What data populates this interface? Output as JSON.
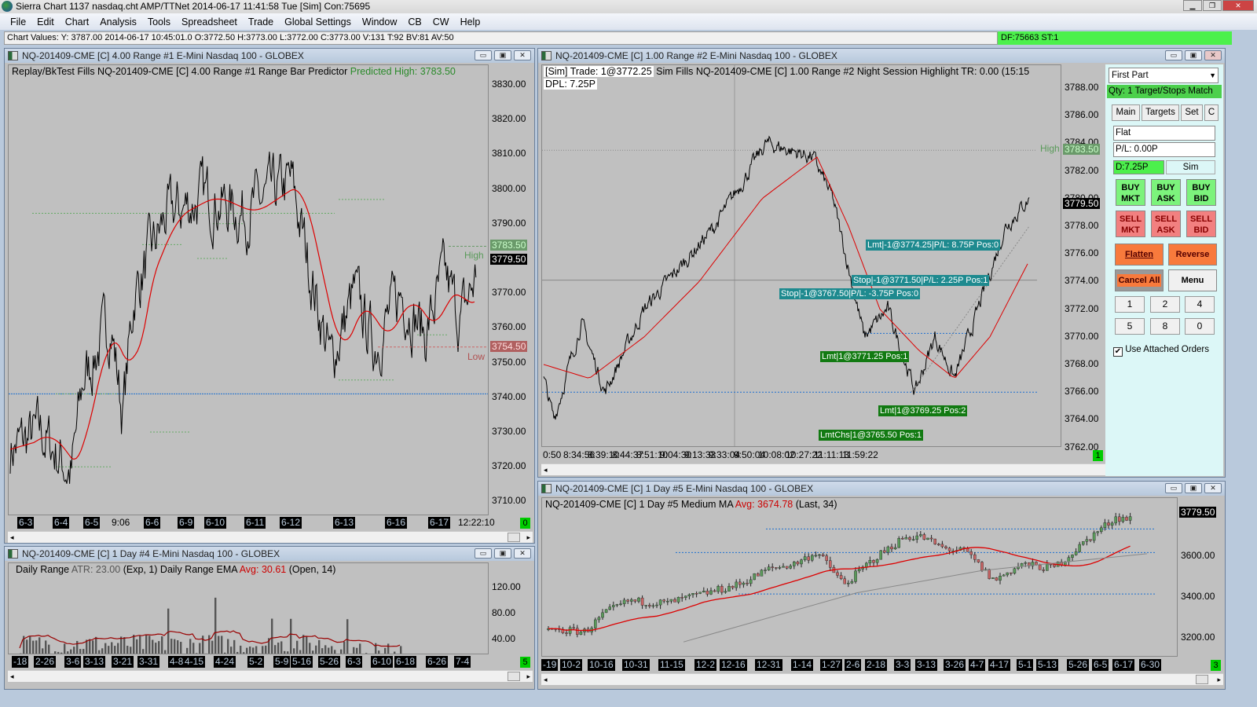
{
  "app": {
    "title": "Sierra Chart 1137 nasdaq.cht  AMP/TTNet 2014-06-17  11:41:58 Tue [Sim]  Con:75695",
    "controls": [
      "▁",
      "❐",
      "✕"
    ]
  },
  "menu": [
    "File",
    "Edit",
    "Chart",
    "Analysis",
    "Tools",
    "Spreadsheet",
    "Trade",
    "Global Settings",
    "Window",
    "CB",
    "CW",
    "Help"
  ],
  "chart_values": "Chart Values: Y: 3787.00  2014-06-17  10:45:01.0  O:3772.50  H:3773.00  L:3772.00  C:3773.00  V:131  T:92  BV:81  AV:50",
  "status": "DF:75663  ST:1",
  "win_controls": [
    "▭",
    "▣",
    "✕"
  ],
  "chart1": {
    "title": "NQ-201409-CME [C]  4.00 Range  #1  E-Mini Nasdaq 100 - GLOBEX",
    "header": "Replay/BkTest Fills  NQ-201409-CME [C]  4.00 Range  #1  Range Bar Predictor",
    "predicted": "Predicted High: 3783.50",
    "prices": [
      "3830.00",
      "3820.00",
      "3810.00",
      "3800.00",
      "3790.00",
      "3780.00",
      "3770.00",
      "3760.00",
      "3750.00",
      "3740.00",
      "3730.00",
      "3720.00",
      "3710.00"
    ],
    "high_label": "High",
    "high_value": "3783.50",
    "last_value": "3779.50",
    "low_label": "Low",
    "low_value": "3754.50",
    "times": [
      "6-3",
      "6-4",
      "6-5",
      "9:06",
      "6-6",
      "6-9",
      "6-10",
      "6-11",
      "6-12",
      "6-13",
      "6-16",
      "6-17",
      "12:22:10"
    ],
    "indicator": "0"
  },
  "chart4": {
    "title": "NQ-201409-CME [C]  1 Day   #4  E-Mini Nasdaq 100 - GLOBEX",
    "h1": "Daily Range",
    "h2": "ATR: 23.00",
    "h3": "(Exp, 1)  Daily Range EMA",
    "h4": "Avg: 30.61",
    "h5": "(Open, 14)",
    "prices": [
      "120.00",
      "80.00",
      "40.00"
    ],
    "times": [
      "-18",
      "2-26",
      "3-6",
      "3-13",
      "3-21",
      "3-31",
      "4-8",
      "4-15",
      "4-24",
      "5-2",
      "5-9",
      "5-16",
      "5-26",
      "6-3",
      "6-10",
      "6-18",
      "6-26",
      "7-4"
    ],
    "indicator": "5"
  },
  "chart2": {
    "title": "NQ-201409-CME [C]  1.00 Range  #2  E-Mini Nasdaq 100 - GLOBEX",
    "sim": "[Sim]  Trade: 1@3772.25",
    "header": " Sim Fills  NQ-201409-CME [C]  1.00 Range  #2  Night Session Highlight  TR: 0.00   (15:15",
    "dpl": "DPL: 7.25P",
    "prices": [
      "3788.00",
      "3786.00",
      "3784.00",
      "3782.00",
      "3780.00",
      "3778.00",
      "3776.00",
      "3774.00",
      "3772.00",
      "3770.00",
      "3768.00",
      "3766.00",
      "3764.00",
      "3762.00"
    ],
    "high_label": "High",
    "high_value": "3783.50",
    "last_value": "3779.50",
    "orders": [
      "Lmt|-1@3774.25|P/L: 8.75P Pos:0",
      "Stop|-1@3771.50|P/L: 2.25P Pos:1",
      "Stop|-1@3767.50|P/L: -3.75P Pos:0",
      "Lmt|1@3771.25 Pos:1",
      "Lmt|1@3769.25 Pos:2",
      "LmtChs|1@3765.50 Pos:1"
    ],
    "times": [
      "0:50",
      "8:34:56",
      "8:39:10",
      "8:44:37",
      "8:51:10",
      "9:04:30",
      "9:13:33",
      "9:33:04",
      "9:50:04",
      "10:08:02",
      "10:27:22",
      "11:11:13",
      "11:59:22"
    ],
    "indicator": "1"
  },
  "trade": {
    "mode": "First Part",
    "qty": "Qty: 1 Target/Stops Match",
    "tabs": [
      "Main",
      "Targets",
      "Set",
      "C"
    ],
    "position": "Flat",
    "pl": "P/L: 0.00P",
    "d": "D:7.25P",
    "sim": "Sim",
    "buy": [
      "BUY MKT",
      "BUY ASK",
      "BUY BID"
    ],
    "sell": [
      "SELL MKT",
      "SELL ASK",
      "SELL BID"
    ],
    "flatten": "Flatten",
    "reverse": "Reverse",
    "cancel_all": "Cancel All",
    "menu": "Menu",
    "qtys": [
      "1",
      "2",
      "4",
      "5",
      "8",
      "0"
    ],
    "attached": "Use Attached Orders",
    "attached_checked": true
  },
  "chart5": {
    "title": "NQ-201409-CME [C]  1 Day   #5  E-Mini Nasdaq 100 - GLOBEX",
    "header": "NQ-201409-CME [C]  1 Day   #5  Medium MA",
    "avg": "Avg: 3674.78",
    "last": "(Last, 34)",
    "prices": [
      "3600.00",
      "3400.00",
      "3200.00"
    ],
    "last_value": "3779.50",
    "times": [
      "-19",
      "10-2",
      "10-16",
      "10-31",
      "11-15",
      "12-2",
      "12-16",
      "12-31",
      "1-14",
      "1-27",
      "2-6",
      "2-18",
      "3-3",
      "3-13",
      "3-26",
      "4-7",
      "4-17",
      "5-1",
      "5-13",
      "5-26",
      "6-5",
      "6-17",
      "6-30"
    ],
    "indicator": "3"
  },
  "colors": {
    "bg": "#c0c0c0",
    "ma": "#d00000",
    "buy": "#7cf37c",
    "sell": "#f28080",
    "accent": "#f87a3c",
    "status": "#4cf04c"
  }
}
